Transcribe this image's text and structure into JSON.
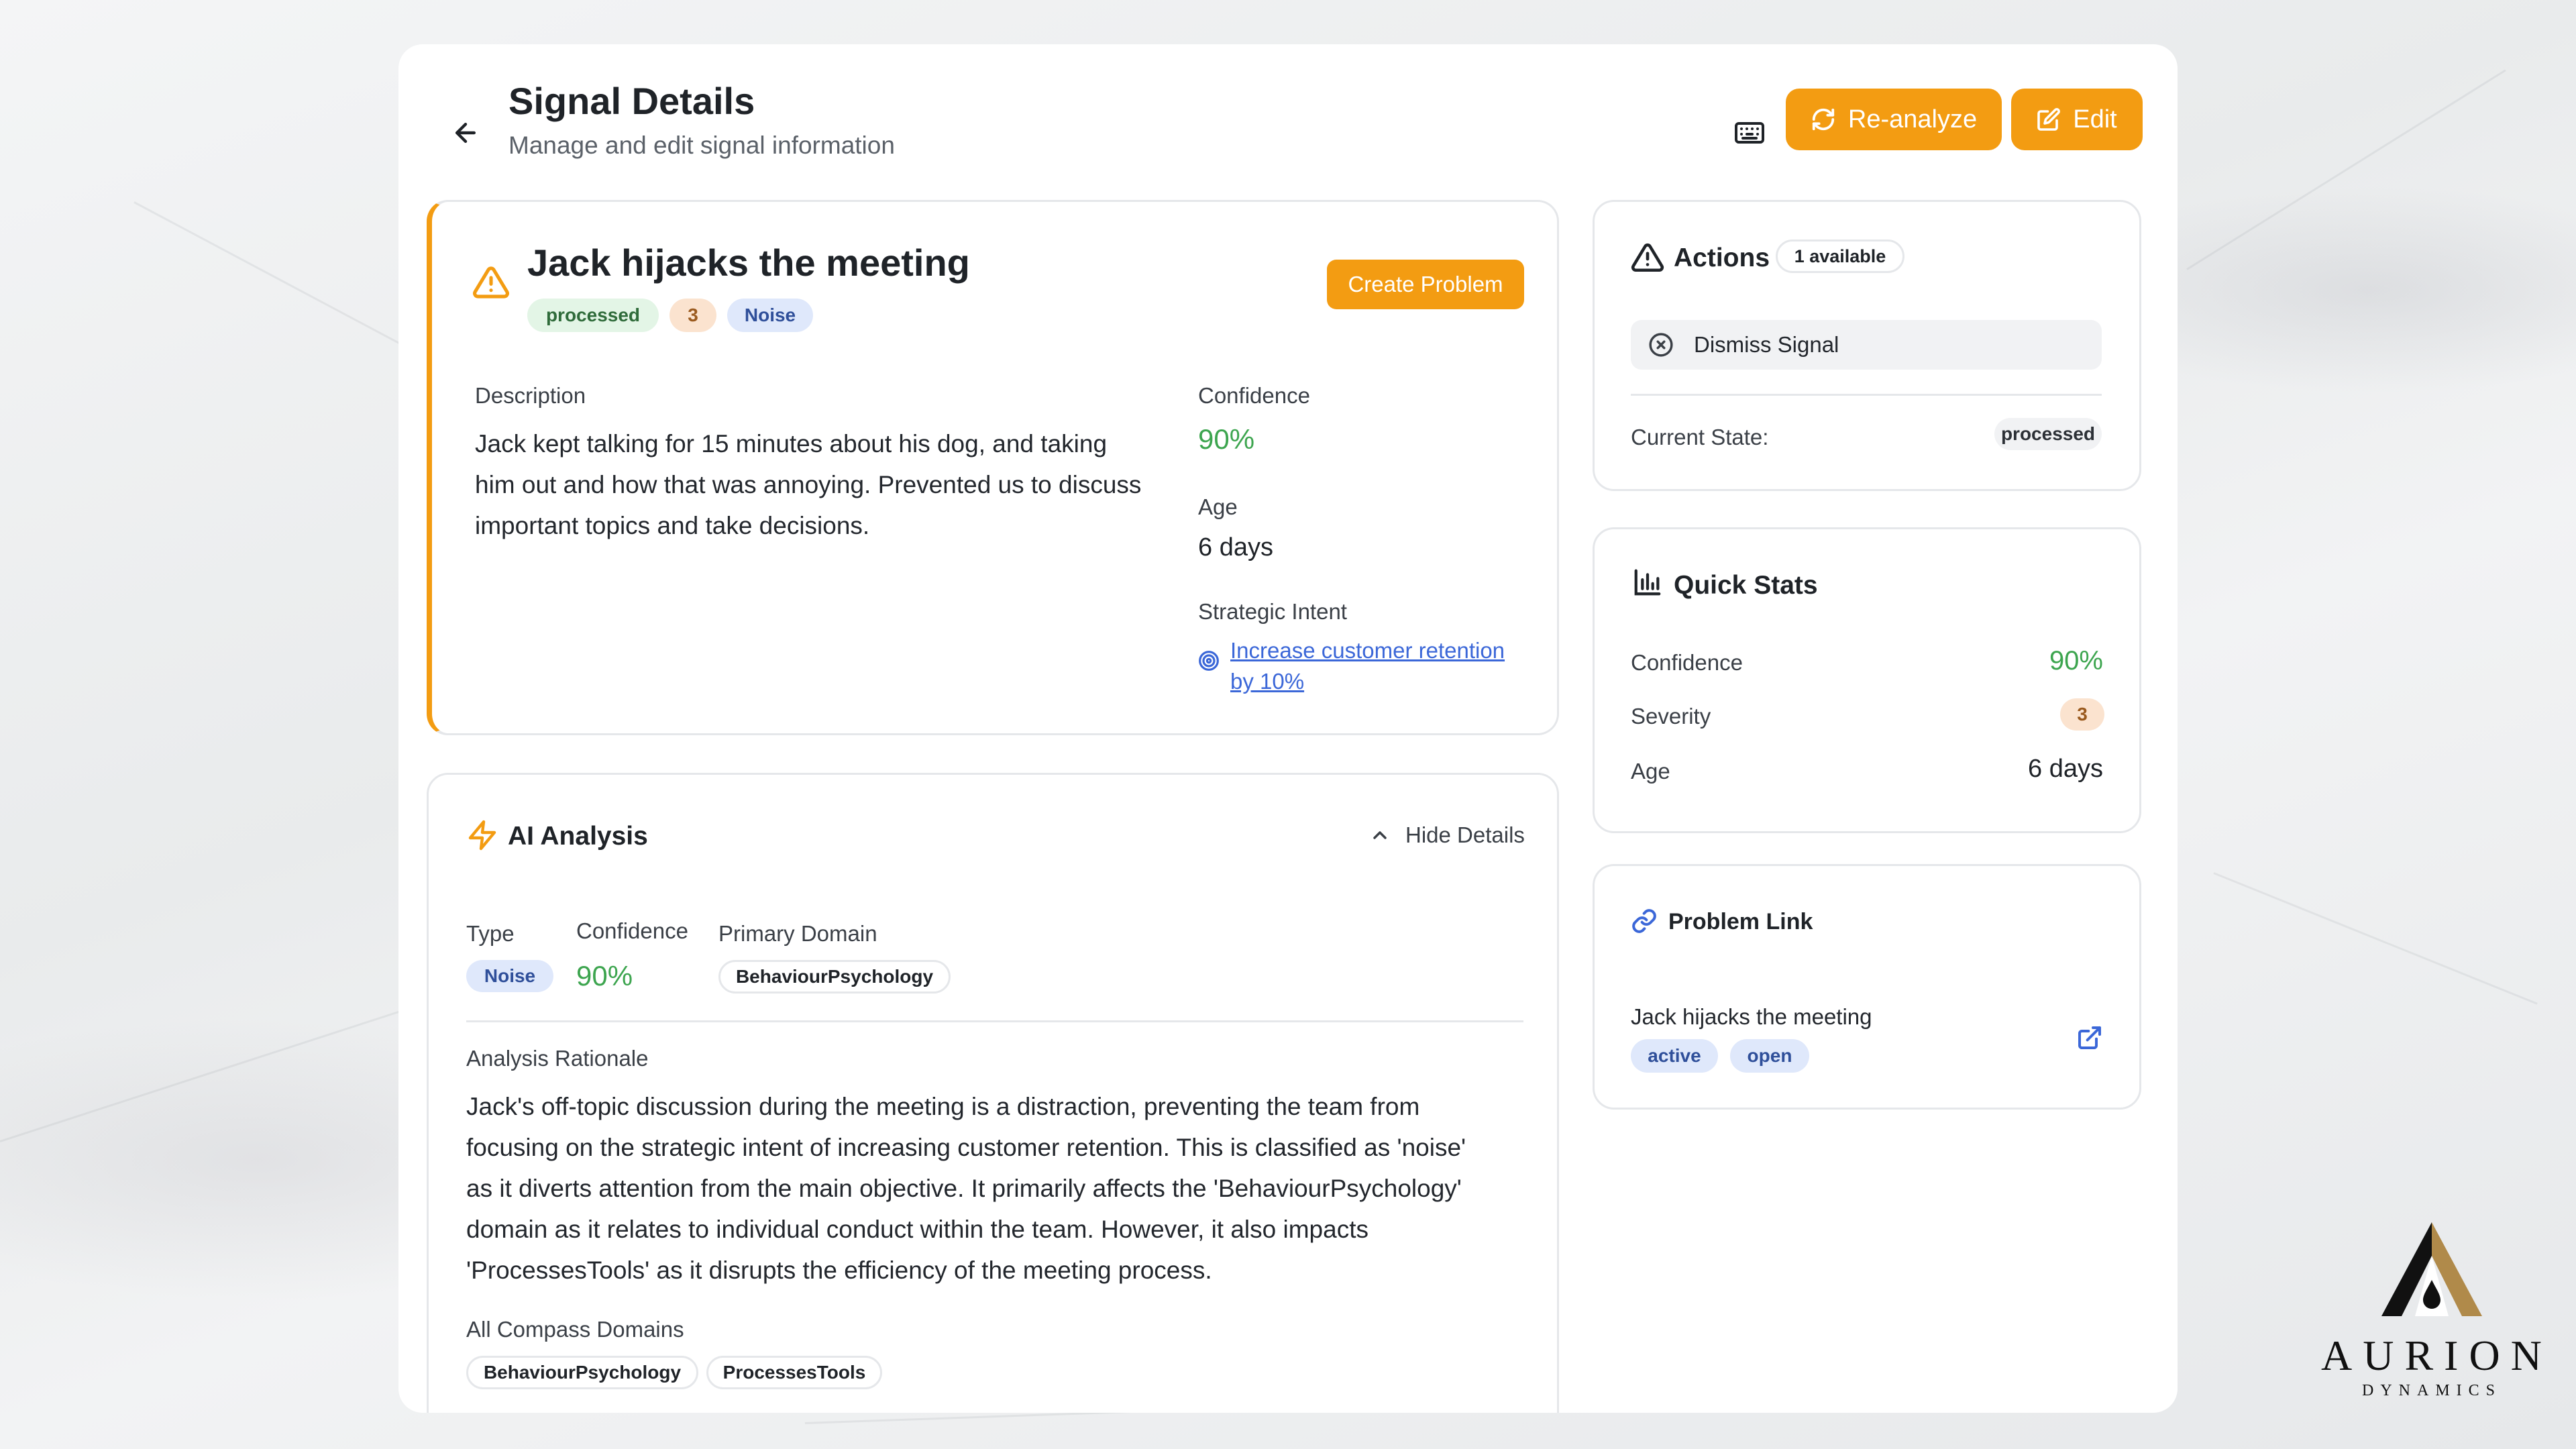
{
  "header": {
    "title": "Signal Details",
    "subtitle": "Manage and edit signal information",
    "reanalyze_label": "Re-analyze",
    "edit_label": "Edit"
  },
  "signal": {
    "title": "Jack hijacks the meeting",
    "status_badge": "processed",
    "severity_badge": "3",
    "type_badge": "Noise",
    "create_problem_label": "Create Problem",
    "description_label": "Description",
    "description_lines": [
      "Jack kept talking for 15 minutes about his dog, and taking",
      "him out and how that was annoying. Prevented us to discuss",
      "important topics and take decisions."
    ],
    "confidence_label": "Confidence",
    "confidence_value": "90%",
    "age_label": "Age",
    "age_value": "6 days",
    "strategic_intent_label": "Strategic Intent",
    "strategic_intent_lines": [
      "Increase customer retention",
      "by 10%"
    ]
  },
  "analysis": {
    "title": "AI Analysis",
    "hide_details_label": "Hide Details",
    "type_label": "Type",
    "type_value": "Noise",
    "confidence_label": "Confidence",
    "confidence_value": "90%",
    "primary_domain_label": "Primary Domain",
    "primary_domain_value": "BehaviourPsychology",
    "rationale_label": "Analysis Rationale",
    "rationale_lines": [
      "Jack's off-topic discussion during the meeting is a distraction, preventing the team from",
      "focusing on the strategic intent of increasing customer retention. This is classified as 'noise'",
      "as it diverts attention from the main objective. It primarily affects the 'BehaviourPsychology'",
      "domain as it relates to individual conduct within the team. However, it also impacts",
      "'ProcessesTools' as it disrupts the efficiency of the meeting process."
    ],
    "compass_label": "All Compass Domains",
    "compass_domains": [
      "BehaviourPsychology",
      "ProcessesTools"
    ]
  },
  "actions": {
    "title": "Actions",
    "available_badge": "1 available",
    "dismiss_label": "Dismiss Signal",
    "current_state_label": "Current State:",
    "current_state_value": "processed"
  },
  "quick_stats": {
    "title": "Quick Stats",
    "confidence_label": "Confidence",
    "confidence_value": "90%",
    "severity_label": "Severity",
    "severity_value": "3",
    "age_label": "Age",
    "age_value": "6 days"
  },
  "problem_link": {
    "title": "Problem Link",
    "problem_name": "Jack hijacks the meeting",
    "status_badges": [
      "active",
      "open"
    ]
  },
  "brand": {
    "name": "AURION",
    "tagline": "DYNAMICS"
  },
  "colors": {
    "accent": "#f39c12",
    "confidence_green": "#3da54f",
    "link_blue": "#3b67d8"
  }
}
